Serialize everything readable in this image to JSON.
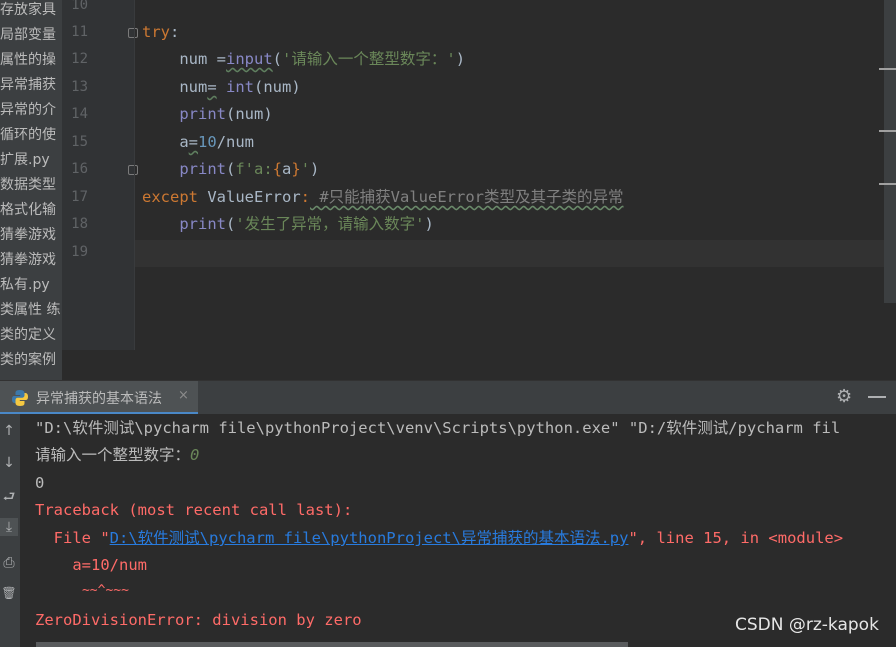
{
  "project_tree": {
    "items": [
      "存放家具",
      "局部变量",
      "属性的操",
      "异常捕获",
      "异常的介",
      "循环的使",
      "扩展.py",
      "数据类型",
      "格式化输",
      "猜拳游戏",
      "猜拳游戏",
      "私有.py",
      "类属性 练",
      "类的定义",
      "类的案例"
    ]
  },
  "editor": {
    "line_numbers": [
      "10",
      "11",
      "12",
      "13",
      "14",
      "15",
      "16",
      "17",
      "18",
      "19"
    ],
    "code": {
      "l11_try": "try",
      "l11_colon": ":",
      "l12_a": "    num =",
      "l12_input": "input",
      "l12_paren": "(",
      "l12_str": "'请输入一个整型数字：'",
      "l12_close": ")",
      "l13_num": "    num",
      "l13_eq": "=",
      "l13_sp": " ",
      "l13_int": "int",
      "l13_rest": "(num)",
      "l14_print": "    print",
      "l14_rest": "(num)",
      "l15_a": "    a",
      "l15_eq": "=",
      "l15_10": "10",
      "l15_rest": "/num",
      "l16_print": "    print",
      "l16_p": "(",
      "l16_f": "f'a:",
      "l16_b1": "{",
      "l16_a": "a",
      "l16_b2": "}",
      "l16_q": "'",
      "l16_close": ")",
      "l17_except": "except",
      "l17_cls": " ValueError",
      "l17_colon": ":",
      "l17_cmt": " #只能捕获ValueError类型及其子类的异常",
      "l18_print": "    print",
      "l18_p": "(",
      "l18_str": "'发生了异常，请输入数字'",
      "l18_close": ")"
    }
  },
  "run_panel": {
    "tab_label": "异常捕获的基本语法",
    "tab_close": "×",
    "gear_glyph": "⚙",
    "console": {
      "cmd": "\"D:\\软件测试\\pycharm file\\pythonProject\\venv\\Scripts\\python.exe\" \"D:/软件测试/pycharm fil",
      "prompt": "请输入一个整型数字：",
      "user_input": "0",
      "echo": "0",
      "traceback": "Traceback (most recent call last):",
      "file_prefix": "  File \"",
      "file_link": "D:\\软件测试\\pycharm file\\pythonProject\\异常捕获的基本语法.py",
      "file_suffix": "\", line 15, in <module>",
      "code_line": "    a=10/num",
      "caret": "      ~~^~~~",
      "error": "ZeroDivisionError: division by zero"
    }
  },
  "tools": {
    "up": "↑",
    "down": "↓",
    "wrap": "⮐",
    "scroll_end": "⤓",
    "print": "⎙",
    "trash": "🗑"
  },
  "watermark": "CSDN @rz-kapok",
  "colors": {
    "background": "#2b2b2b",
    "keyword": "#cc7832",
    "builtin": "#8888c6",
    "string": "#6a8759",
    "number": "#6897bb",
    "comment": "#808080",
    "error": "#ff6b68",
    "link": "#287bde"
  }
}
